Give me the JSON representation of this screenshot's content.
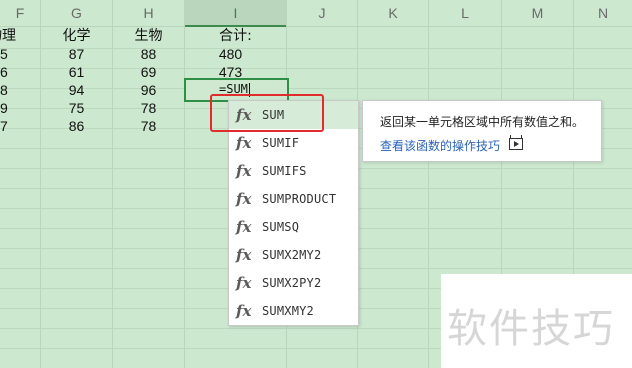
{
  "columns": [
    "F",
    "G",
    "H",
    "I",
    "J",
    "K",
    "L",
    "M",
    "N"
  ],
  "active_column": "I",
  "rows": [
    {
      "f": "物理",
      "g": "化学",
      "h": "生物",
      "i": "合计:"
    },
    {
      "f": "5",
      "g": "87",
      "h": "88",
      "i": "480"
    },
    {
      "f": "6",
      "g": "61",
      "h": "69",
      "i": "473"
    },
    {
      "f": "8",
      "g": "94",
      "h": "96",
      "i": ""
    },
    {
      "f": "9",
      "g": "75",
      "h": "78",
      "i": ""
    },
    {
      "f": "7",
      "g": "86",
      "h": "78",
      "i": ""
    }
  ],
  "active_cell": {
    "value": "=SUM"
  },
  "autocomplete": {
    "icon": "fx-icon",
    "fx_label": "fx",
    "items": [
      "SUM",
      "SUMIF",
      "SUMIFS",
      "SUMPRODUCT",
      "SUMSQ",
      "SUMX2MY2",
      "SUMX2PY2",
      "SUMXMY2"
    ],
    "selected": "SUM"
  },
  "tooltip": {
    "description": "返回某一单元格区域中所有数值之和。",
    "link": "查看该函数的操作技巧",
    "link_icon": "video-play-icon"
  },
  "watermark": {
    "text": "软件技巧"
  },
  "colors": {
    "sheet_bg": "#cce8cf",
    "active_border": "#2f8f46",
    "highlight_box": "#e02c2c",
    "link": "#2a62b8"
  }
}
